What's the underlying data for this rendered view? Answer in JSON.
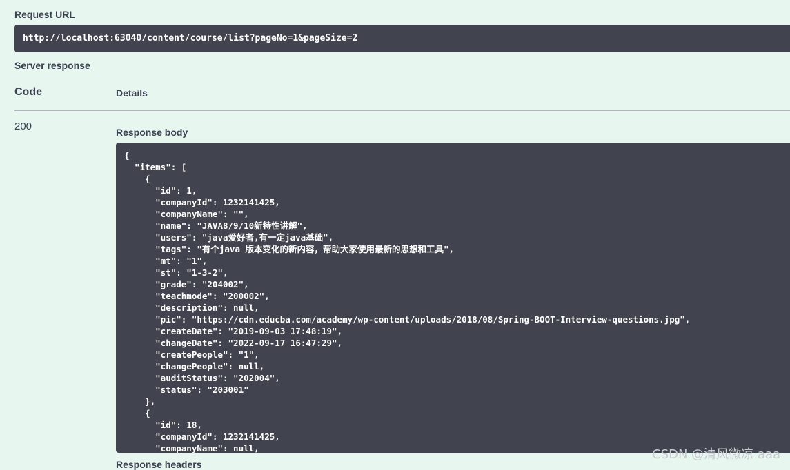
{
  "request_url": {
    "label": "Request URL",
    "value": "http://localhost:63040/content/course/list?pageNo=1&pageSize=2"
  },
  "server_response": {
    "label": "Server response",
    "code_header": "Code",
    "details_header": "Details",
    "status_code": "200",
    "response_body_label": "Response body",
    "response_body": "{\n  \"items\": [\n    {\n      \"id\": 1,\n      \"companyId\": 1232141425,\n      \"companyName\": \"\",\n      \"name\": \"JAVA8/9/10新特性讲解\",\n      \"users\": \"java爱好者,有一定java基础\",\n      \"tags\": \"有个java 版本变化的新内容，帮助大家使用最新的思想和工具\",\n      \"mt\": \"1\",\n      \"st\": \"1-3-2\",\n      \"grade\": \"204002\",\n      \"teachmode\": \"200002\",\n      \"description\": null,\n      \"pic\": \"https://cdn.educba.com/academy/wp-content/uploads/2018/08/Spring-BOOT-Interview-questions.jpg\",\n      \"createDate\": \"2019-09-03 17:48:19\",\n      \"changeDate\": \"2022-09-17 16:47:29\",\n      \"createPeople\": \"1\",\n      \"changePeople\": null,\n      \"auditStatus\": \"202004\",\n      \"status\": \"203001\"\n    },\n    {\n      \"id\": 18,\n      \"companyId\": 1232141425,\n      \"companyName\": null,",
    "response_headers_label": "Response headers"
  },
  "watermark": "CSDN @清风微凉 aaa"
}
